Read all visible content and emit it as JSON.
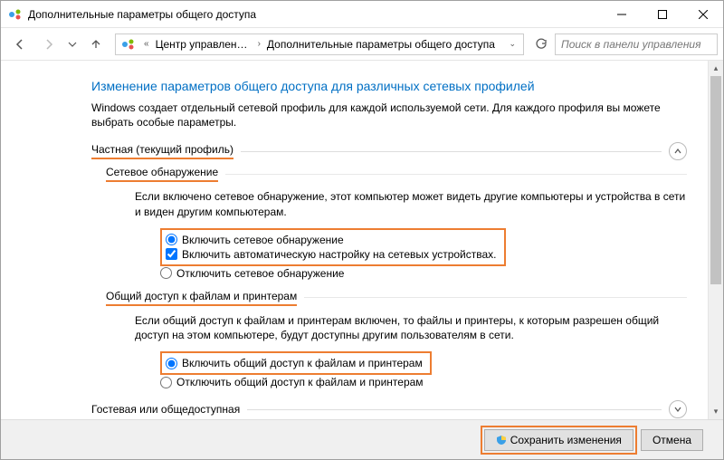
{
  "window": {
    "title": "Дополнительные параметры общего доступа"
  },
  "nav": {
    "crumb1": "Центр управлени...",
    "crumb2": "Дополнительные параметры общего доступа",
    "search_placeholder": "Поиск в панели управления"
  },
  "page": {
    "heading": "Изменение параметров общего доступа для различных сетевых профилей",
    "intro": "Windows создает отдельный сетевой профиль для каждой используемой сети. Для каждого профиля вы можете выбрать особые параметры.",
    "sec_private": "Частная (текущий профиль)",
    "sec_guest": "Гостевая или общедоступная",
    "discovery": {
      "title": "Сетевое обнаружение",
      "desc": "Если включено сетевое обнаружение, этот компьютер может видеть другие компьютеры и устройства в сети и виден другим компьютерам.",
      "on": "Включить сетевое обнаружение",
      "auto": "Включить автоматическую настройку на сетевых устройствах.",
      "off": "Отключить сетевое обнаружение"
    },
    "fileshare": {
      "title": "Общий доступ к файлам и принтерам",
      "desc": "Если общий доступ к файлам и принтерам включен, то файлы и принтеры, к которым разрешен общий доступ на этом компьютере, будут доступны другим пользователям в сети.",
      "on": "Включить общий доступ к файлам и принтерам",
      "off": "Отключить общий доступ к файлам и принтерам"
    }
  },
  "footer": {
    "save": "Сохранить изменения",
    "cancel": "Отмена"
  }
}
